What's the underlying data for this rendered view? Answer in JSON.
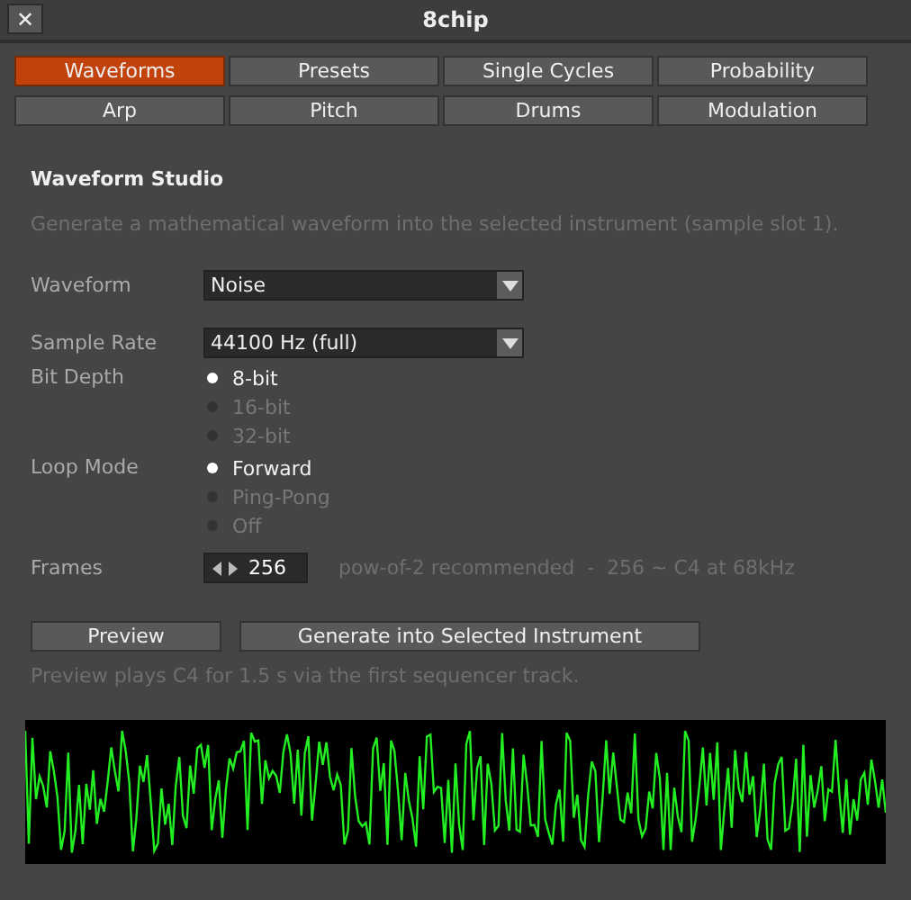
{
  "window": {
    "title": "8chip",
    "close": "✕"
  },
  "tabs": [
    {
      "label": "Waveforms",
      "selected": true
    },
    {
      "label": "Presets",
      "selected": false
    },
    {
      "label": "Single Cycles",
      "selected": false
    },
    {
      "label": "Probability",
      "selected": false
    },
    {
      "label": "Arp",
      "selected": false
    },
    {
      "label": "Pitch",
      "selected": false
    },
    {
      "label": "Drums",
      "selected": false
    },
    {
      "label": "Modulation",
      "selected": false
    }
  ],
  "heading": "Waveform Studio",
  "description": "Generate a mathematical waveform into the selected instrument (sample slot 1).",
  "waveform": {
    "label": "Waveform",
    "value": "Noise"
  },
  "sample_rate": {
    "label": "Sample Rate",
    "value": "44100 Hz (full)"
  },
  "bit_depth": {
    "label": "Bit Depth",
    "options": [
      {
        "label": "8-bit",
        "selected": true
      },
      {
        "label": "16-bit",
        "selected": false
      },
      {
        "label": "32-bit",
        "selected": false
      }
    ]
  },
  "loop_mode": {
    "label": "Loop Mode",
    "options": [
      {
        "label": "Forward",
        "selected": true
      },
      {
        "label": "Ping-Pong",
        "selected": false
      },
      {
        "label": "Off",
        "selected": false
      }
    ]
  },
  "frames": {
    "label": "Frames",
    "value": "256",
    "hint": "pow-of-2 recommended  -  256 ~ C4 at 68kHz"
  },
  "buttons": [
    "Preview",
    "Generate into Selected Instrument"
  ],
  "note": "Preview plays C4 for 1.5 s via the first sequencer track."
}
